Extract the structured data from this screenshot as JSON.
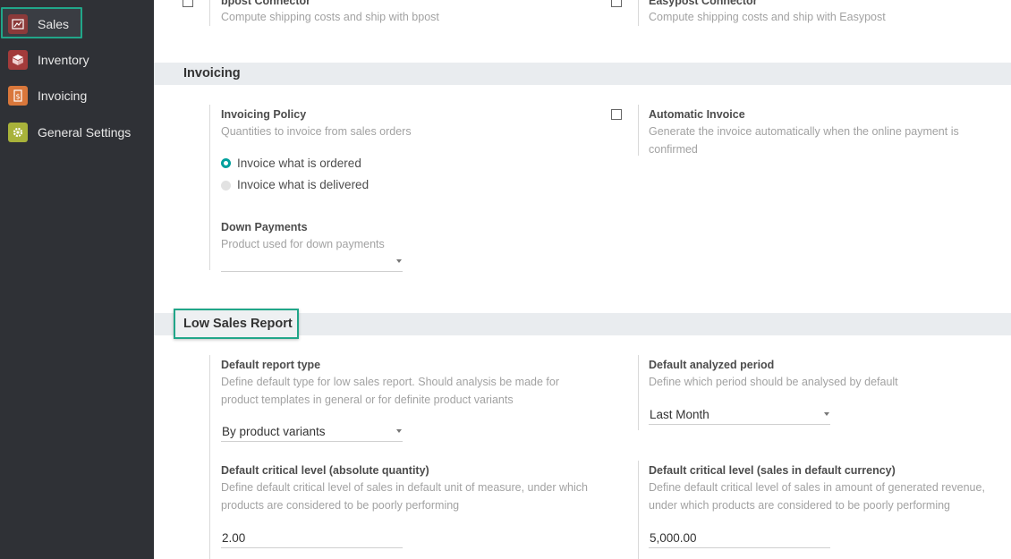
{
  "sidebar": {
    "items": [
      {
        "label": "Sales",
        "icon": "sales-chart-icon",
        "color": "#8c3a3a"
      },
      {
        "label": "Inventory",
        "icon": "inventory-box-icon",
        "color": "#a33b3b"
      },
      {
        "label": "Invoicing",
        "icon": "invoice-dollar-icon",
        "color": "#d9773b"
      },
      {
        "label": "General Settings",
        "icon": "gear-icon",
        "color": "#a8b23a"
      }
    ],
    "active": "Sales"
  },
  "shipping": {
    "bpost": {
      "title": "bpost Connector",
      "desc": "Compute shipping costs and ship with bpost"
    },
    "easypost": {
      "title": "Easypost Connector",
      "desc": "Compute shipping costs and ship with Easypost"
    }
  },
  "invoicing": {
    "section_title": "Invoicing",
    "policy": {
      "title": "Invoicing Policy",
      "desc": "Quantities to invoice from sales orders",
      "options": [
        "Invoice what is ordered",
        "Invoice what is delivered"
      ],
      "selected": 0
    },
    "automatic": {
      "title": "Automatic Invoice",
      "desc": "Generate the invoice automatically when the online payment is confirmed"
    },
    "down_payments": {
      "title": "Down Payments",
      "desc": "Product used for down payments",
      "value": ""
    }
  },
  "low_sales": {
    "section_title": "Low Sales Report",
    "report_type": {
      "title": "Default report type",
      "desc": "Define default type for low sales report. Should analysis be made for product templates in general or for definite product variants",
      "value": "By product variants"
    },
    "analyzed_period": {
      "title": "Default analyzed period",
      "desc": "Define which period should be analysed by default",
      "value": "Last Month"
    },
    "critical_qty": {
      "title": "Default critical level (absolute quantity)",
      "desc": "Define default critical level of sales in default unit of measure, under which products are considered to be poorly performing",
      "value": "2.00"
    },
    "critical_currency": {
      "title": "Default critical level (sales in default currency)",
      "desc": "Define default critical level of sales in amount of generated revenue, under which products are considered to be poorly performing",
      "value": "5,000.00"
    }
  },
  "colors": {
    "accent": "#21a689",
    "radio": "#00a09d",
    "sidebar_bg": "#2f3136"
  }
}
